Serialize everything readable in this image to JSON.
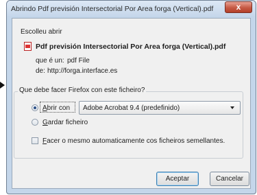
{
  "window": {
    "title": "Abrindo Pdf previsión Intersectorial Por Area forga (Vertical).pdf",
    "close_glyph": "x"
  },
  "dialog": {
    "intro": "Escolleu abrir",
    "file_icon": "pdf-file-icon",
    "file_name": "Pdf previsión Intersectorial Por Area forga (Vertical).pdf",
    "type_label": "que é un:",
    "type_value": "pdf File",
    "from_label": "de:",
    "from_value": "http://forga.interface.es",
    "question": "Que debe facer Firefox con este ficheiro?",
    "open_with": {
      "prefix": "",
      "underlined": "A",
      "rest": "brir con",
      "checked": true
    },
    "app_select": {
      "selected": "Adobe Acrobat 9.4 (predefinido)"
    },
    "save_file": {
      "underlined": "G",
      "rest": "ardar ficheiro",
      "checked": false
    },
    "remember": {
      "underlined": "F",
      "rest": "acer o mesmo automaticamente cos ficheiros semellantes.",
      "checked": false
    },
    "ok_label": "Aceptar",
    "cancel_label": "Cancelar"
  }
}
